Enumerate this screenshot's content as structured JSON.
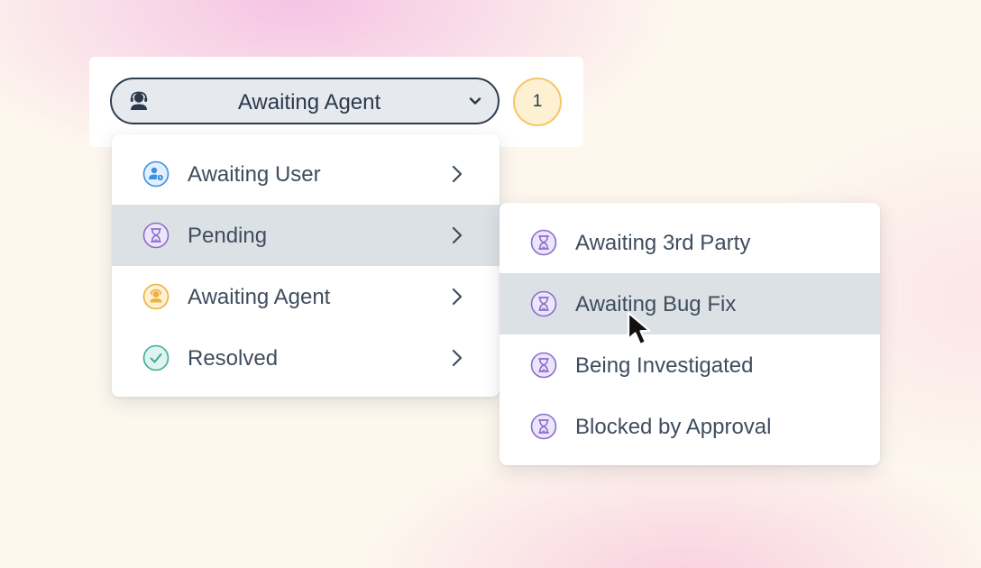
{
  "status_select": {
    "label": "Awaiting Agent",
    "icon": "agent-icon",
    "chevron_icon": "chevron-down-icon"
  },
  "count_badge": {
    "value": "1"
  },
  "primary_menu": {
    "items": [
      {
        "label": "Awaiting User",
        "icon": "user-clock-icon",
        "icon_color": "#3b8fe0",
        "highlighted": false
      },
      {
        "label": "Pending",
        "icon": "hourglass-icon",
        "icon_color": "#8a6dcc",
        "highlighted": true
      },
      {
        "label": "Awaiting Agent",
        "icon": "agent-icon",
        "icon_color": "#efb03e",
        "highlighted": false
      },
      {
        "label": "Resolved",
        "icon": "check-icon",
        "icon_color": "#3aaa96",
        "highlighted": false
      }
    ]
  },
  "pending_submenu": {
    "items": [
      {
        "label": "Awaiting 3rd Party",
        "icon": "hourglass-icon",
        "highlighted": false
      },
      {
        "label": "Awaiting Bug Fix",
        "icon": "hourglass-icon",
        "highlighted": true
      },
      {
        "label": "Being Investigated",
        "icon": "hourglass-icon",
        "highlighted": false
      },
      {
        "label": "Blocked by Approval",
        "icon": "hourglass-icon",
        "highlighted": false
      }
    ]
  },
  "colors": {
    "select_border": "#2d3d52",
    "select_bg": "#e6eaee",
    "highlight_bg": "#dce1e5",
    "badge_border": "#f4c766",
    "badge_bg": "#fdf0d3",
    "text": "#3f4d5e"
  }
}
